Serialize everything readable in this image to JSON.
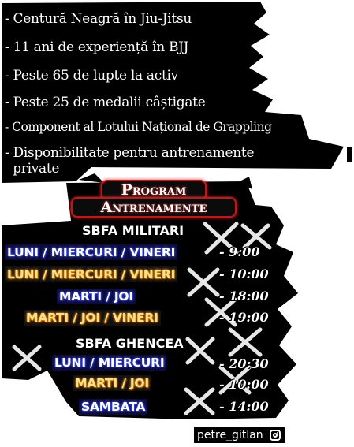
{
  "highlights": [
    "- Centură Neagră în Jiu-Jitsu",
    "- 11 ani de experiență în BJJ",
    "- Peste 65 de lupte la activ",
    "- Peste 25 de medalii câștigate",
    "- Component al Lotului Național de Grappling",
    "- Disponibilitate pentru antrenamente",
    "  private"
  ],
  "program": {
    "title_line1": "Program",
    "title_line2": "Antrenamente"
  },
  "locations": [
    {
      "name": "SBFA MILITARI",
      "sessions": [
        {
          "days": "LUNI / MIERCURI / VINERI",
          "time": "-   9:00",
          "style": "blue"
        },
        {
          "days": "LUNI / MIERCURI / VINERI",
          "time": "- 10:00",
          "style": "gold"
        },
        {
          "days": "MARTI / JOI",
          "time": "- 18:00",
          "style": "blue"
        },
        {
          "days": "MARTI / JOI / VINERI",
          "time": "- 19:00",
          "style": "gold"
        }
      ]
    },
    {
      "name": "SBFA GHENCEA",
      "sessions": [
        {
          "days": "LUNI / MIERCURI",
          "time": "- 20:30",
          "style": "blue"
        },
        {
          "days": "MARTI / JOI",
          "time": "- 10:00",
          "style": "gold"
        },
        {
          "days": "SAMBATA",
          "time": "- 14:00",
          "style": "blue"
        }
      ]
    }
  ],
  "instagram": {
    "handle": "petre_gitlan",
    "icon": "instagram-icon"
  },
  "colors": {
    "background": "#ffffff",
    "panel": "#000000",
    "accent_red": "#c01818",
    "day_blue_glow": "#3a4dff",
    "day_gold": "#ffe08a"
  }
}
